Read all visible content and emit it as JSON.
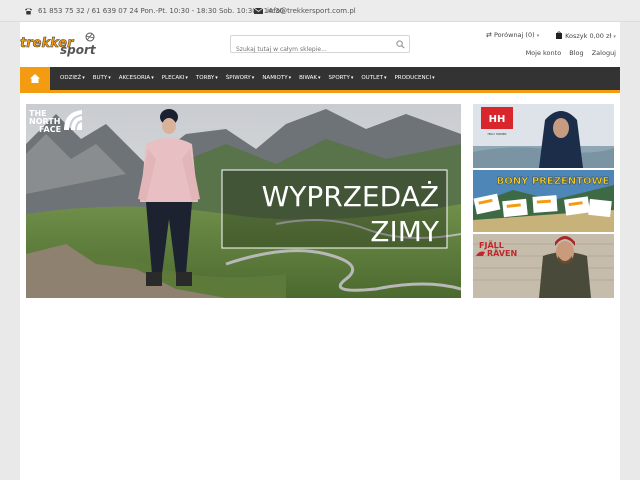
{
  "topbar": {
    "phone_text": "61 853 75 32 / 61 639 07 24 Pon.-Pt. 10:30 - 18:30 Sob. 10:30 - 14:30",
    "email": "info@trekkersport.com.pl"
  },
  "header": {
    "logo_text_1": "trekker",
    "logo_text_2": "sport",
    "search_placeholder": "Szukaj tutaj w całym sklepie...",
    "compare_label": "Porównaj (0)",
    "cart_label": "Koszyk 0,00 zł",
    "user_links": [
      "Moje konto",
      "Blog",
      "Zaloguj"
    ]
  },
  "nav": {
    "items": [
      "ODZIEŻ",
      "BUTY",
      "AKCESORIA",
      "PLECAKI",
      "TORBY",
      "ŚPIWORY",
      "NAMIOTY",
      "BIWAK",
      "SPORTY",
      "OUTLET",
      "PRODUCENCI"
    ]
  },
  "hero": {
    "brand": "THE NORTH FACE",
    "brand_line1": "THE",
    "brand_line2": "NORTH",
    "brand_line3": "FACE",
    "headline_1": "WYPRZEDAŻ",
    "headline_2": "ZIMY"
  },
  "side_banners": {
    "hh_logo": "HH",
    "hh_sub": "HELLY HANSEN",
    "vouchers": "BONY PREZENTOWE",
    "fjall_1": "FJÄLL",
    "fjall_2": "RÄVEN"
  },
  "colors": {
    "accent": "#f39c12",
    "nav_bg": "#333333",
    "page_bg": "#e9e9e9"
  }
}
